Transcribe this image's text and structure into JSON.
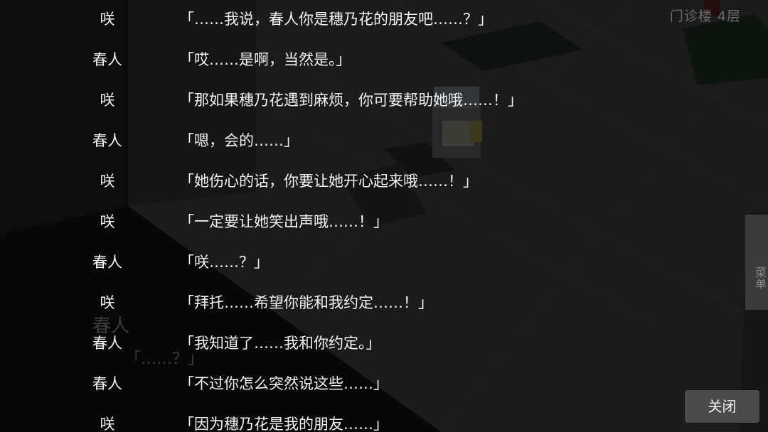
{
  "location": "门诊楼 4层",
  "menu_label": "菜单",
  "close_label": "关闭",
  "ghost_dialogue": {
    "speaker": "春人",
    "text": "「……？」"
  },
  "backlog": [
    {
      "speaker": "咲",
      "text": "「……我说，春人你是穗乃花的朋友吧……？」"
    },
    {
      "speaker": "春人",
      "text": "「哎……是啊，当然是。」"
    },
    {
      "speaker": "咲",
      "text": "「那如果穗乃花遇到麻烦，你可要帮助她哦……！」"
    },
    {
      "speaker": "春人",
      "text": "「嗯，会的……」"
    },
    {
      "speaker": "咲",
      "text": "「她伤心的话，你要让她开心起来哦……！」"
    },
    {
      "speaker": "咲",
      "text": "「一定要让她笑出声哦……！」"
    },
    {
      "speaker": "春人",
      "text": "「咲……？」"
    },
    {
      "speaker": "咲",
      "text": "「拜托……希望你能和我约定……！」"
    },
    {
      "speaker": "春人",
      "text": "「我知道了……我和你约定。」"
    },
    {
      "speaker": "春人",
      "text": "「不过你怎么突然说这些……」"
    },
    {
      "speaker": "咲",
      "text": "「因为穗乃花是我的朋友……」"
    }
  ]
}
